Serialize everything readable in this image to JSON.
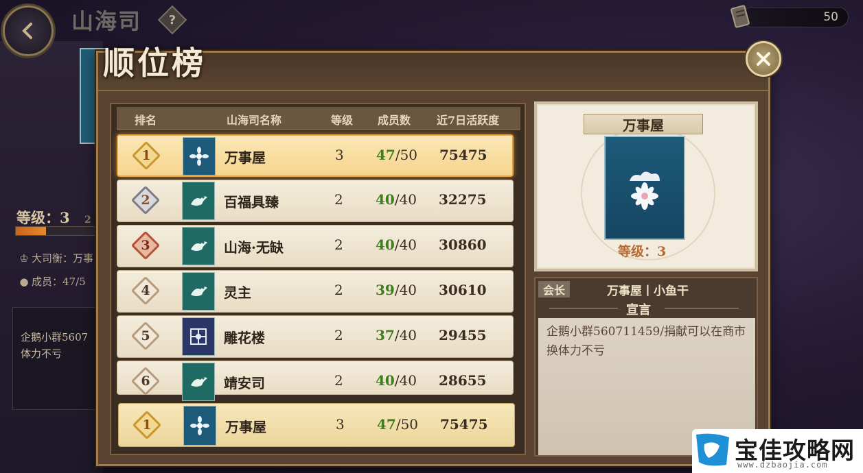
{
  "background": {
    "page_title": "山海司",
    "level_label": "等级：3",
    "level_extra": "2",
    "leader_label": "大司衡：万事",
    "members_label": "成员：47/5",
    "notice": "企鹅小群5607 体力不亏"
  },
  "currency": {
    "value": "50"
  },
  "modal": {
    "title": "顺位榜"
  },
  "ranking": {
    "headers": {
      "rank": "排名",
      "name": "山海司名称",
      "level": "等级",
      "members": "成员数",
      "activity": "近7日活跃度"
    },
    "rows": [
      {
        "rank": "1",
        "name": "万事屋",
        "level": "3",
        "members_current": "47",
        "members_max": "/50",
        "activity": "75475"
      },
      {
        "rank": "2",
        "name": "百福具臻",
        "level": "2",
        "members_current": "40",
        "members_max": "/40",
        "activity": "32275"
      },
      {
        "rank": "3",
        "name": "山海·无缺",
        "level": "2",
        "members_current": "40",
        "members_max": "/40",
        "activity": "30860"
      },
      {
        "rank": "4",
        "name": "灵主",
        "level": "2",
        "members_current": "39",
        "members_max": "/40",
        "activity": "30610"
      },
      {
        "rank": "5",
        "name": "雕花楼",
        "level": "2",
        "members_current": "37",
        "members_max": "/40",
        "activity": "29455"
      },
      {
        "rank": "6",
        "name": "靖安司",
        "level": "2",
        "members_current": "40",
        "members_max": "/40",
        "activity": "28655"
      }
    ],
    "my_row": {
      "rank": "1",
      "name": "万事屋",
      "level": "3",
      "members_current": "47",
      "members_max": "/50",
      "activity": "75475"
    }
  },
  "detail": {
    "name": "万事屋",
    "level": "等级：3",
    "leader_tag": "会长",
    "leader_name": "万事屋丨小鱼干",
    "declaration_title": "宣言",
    "declaration_text": "企鹅小群560711459/捐献可以在商市换体力不亏"
  },
  "brand": {
    "name": "宝佳攻略网",
    "url": "www.dzbaojia.com"
  },
  "colors": {
    "gold": "#eaa33a",
    "members_green": "#3f7d1e",
    "rank1": "#c9962e",
    "rank2": "#7c7c86",
    "rank3": "#b5503a",
    "rank_other": "#b59a7c",
    "teal_emblem": "#1f6a62",
    "blue_emblem": "#1d5a79",
    "navy_emblem": "#2a3768"
  }
}
